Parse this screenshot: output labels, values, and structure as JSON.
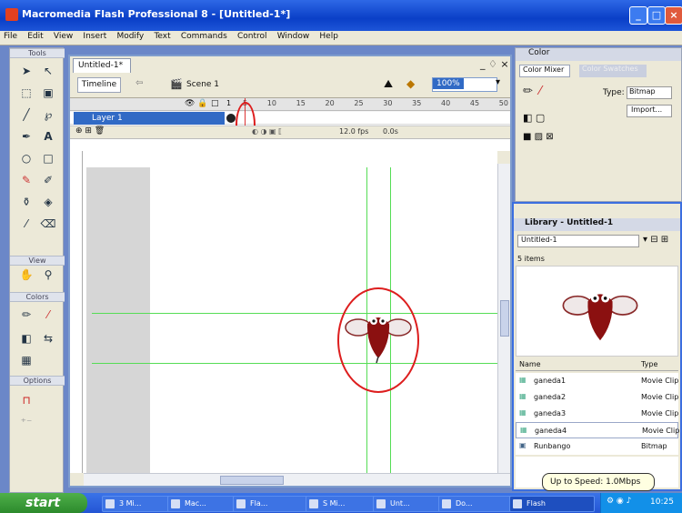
{
  "window": {
    "title": "Macromedia Flash Professional 8 - [Untitled-1*]"
  },
  "menu": [
    "File",
    "Edit",
    "View",
    "Insert",
    "Modify",
    "Text",
    "Commands",
    "Control",
    "Window",
    "Help"
  ],
  "tools": {
    "title": "Tools",
    "view_label": "View",
    "colors_label": "Colors",
    "options_label": "Options"
  },
  "document": {
    "tab": "Untitled-1*",
    "timeline_button": "Timeline",
    "scene": "Scene 1",
    "zoom": "100%",
    "layer_name": "Layer 1",
    "frame_numbers": [
      "5",
      "10",
      "15",
      "20",
      "25",
      "30",
      "35",
      "40",
      "45",
      "50"
    ],
    "frame_rate": "12.0 fps",
    "elapsed": "0.0s",
    "frame_index": "1"
  },
  "color_panel": {
    "title": "Color",
    "tab1": "Color Mixer",
    "tab2": "Color Swatches",
    "type_label": "Type:",
    "type_value": "Bitmap",
    "import_label": "Import..."
  },
  "library": {
    "title": "Library - Untitled-1",
    "doc_select": "Untitled-1",
    "count": "5 items",
    "col_name": "Name",
    "col_type": "Type",
    "items": [
      {
        "name": "ganeda1",
        "type": "Movie Clip"
      },
      {
        "name": "ganeda2",
        "type": "Movie Clip"
      },
      {
        "name": "ganeda3",
        "type": "Movie Clip"
      },
      {
        "name": "ganeda4",
        "type": "Movie Clip"
      },
      {
        "name": "Runbango",
        "type": "Bitmap"
      }
    ]
  },
  "tooltip": "Up to Speed: 1.0Mbps",
  "taskbar": {
    "start": "start",
    "tasks": [
      "3 Mi...",
      "Mac...",
      "Fla...",
      "S Mi...",
      "Unt...",
      "Do...",
      "Flash"
    ],
    "clock": "10:25"
  },
  "colors": {
    "stage_bg": "#ffffff",
    "guide_line": "#55dd55",
    "highlight_circle": "#dd1e1e",
    "bug_body": "#8b1010"
  }
}
